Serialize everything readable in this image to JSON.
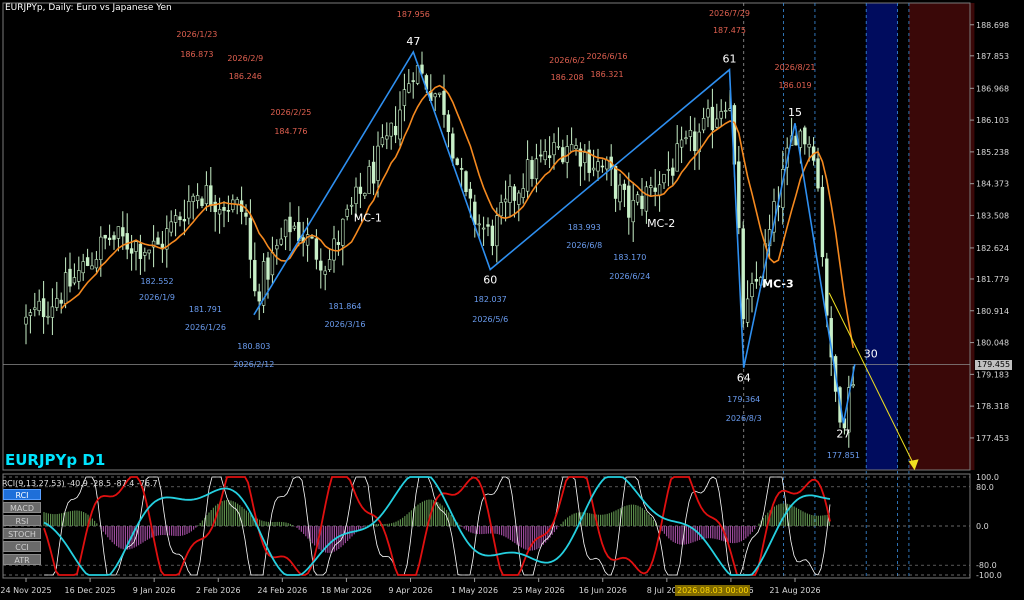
{
  "window": {
    "title": "EURJPYp, Daily:  Euro vs Japanese Yen",
    "symbol_label": "EURJPYp D1"
  },
  "indicator": {
    "caption": "RCI(9,13,27,53) -40.9 -28.5 -87.4 -76.7",
    "buttons": [
      {
        "label": "RCI",
        "active": true
      },
      {
        "label": "MACD",
        "active": false
      },
      {
        "label": "RSI",
        "active": false
      },
      {
        "label": "STOCH",
        "active": false
      },
      {
        "label": "CCI",
        "active": false
      },
      {
        "label": "ATR",
        "active": false
      }
    ],
    "levels": [
      "100.0",
      "80.0",
      "0.0",
      "-80.0",
      "-100.0"
    ]
  },
  "crosshair": {
    "date_label": "2026.08.03 00:00",
    "price_label": "179.455"
  },
  "colors": {
    "background": "#000000",
    "candle": "#c8f0c8",
    "ma": "#f5891f",
    "zigzag": "#2e8ff0",
    "forecast_arrow": "#f0e020",
    "label_high": "#e06050",
    "label_low": "#6a9cf0",
    "rci_fast": "#ffffff",
    "rci_mid": "#e01010",
    "rci_slow": "#25d0e0",
    "zone_blue": "#000c5e",
    "zone_red": "#3a0808"
  },
  "chart_data": {
    "type": "candlestick",
    "title": "EURJPYp, Daily:  Euro vs Japanese Yen",
    "x_ticks": [
      "24 Nov 2025",
      "16 Dec 2025",
      "9 Jan 2026",
      "2 Feb 2026",
      "24 Feb 2026",
      "18 Mar 2026",
      "9 Apr 2026",
      "1 May 2026",
      "25 May 2026",
      "16 Jun 2026",
      "8 Jul 2026",
      "30 Jul 2026",
      "21 Aug 2026"
    ],
    "y_ticks": [
      188.698,
      187.853,
      186.968,
      186.103,
      185.238,
      184.373,
      183.508,
      182.624,
      181.779,
      180.914,
      180.048,
      179.183,
      178.318,
      177.453
    ],
    "ylim": [
      176.58,
      189.29
    ],
    "current_price": 179.455,
    "anchors": [
      {
        "date": "2025-11-24",
        "price": 180.6
      },
      {
        "date": "2025-12-09",
        "price": 181.6
      },
      {
        "date": "2025-12-23",
        "price": 182.9
      },
      {
        "date": "2026-01-09",
        "price": 182.6
      },
      {
        "date": "2026-01-23",
        "price": 184.2
      },
      {
        "date": "2026-02-09",
        "price": 183.6
      },
      {
        "date": "2026-02-12",
        "price": 181.3
      },
      {
        "date": "2026-02-25",
        "price": 183.3
      },
      {
        "date": "2026-03-10",
        "price": 182.2
      },
      {
        "date": "2026-03-16",
        "price": 183.3
      },
      {
        "date": "2026-04-01",
        "price": 185.6
      },
      {
        "date": "2026-04-09",
        "price": 187.6
      },
      {
        "date": "2026-04-20",
        "price": 186.5
      },
      {
        "date": "2026-04-28",
        "price": 183.7
      },
      {
        "date": "2026-05-06",
        "price": 182.9
      },
      {
        "date": "2026-05-18",
        "price": 184.6
      },
      {
        "date": "2026-06-02",
        "price": 185.5
      },
      {
        "date": "2026-06-16",
        "price": 184.7
      },
      {
        "date": "2026-06-24",
        "price": 183.6
      },
      {
        "date": "2026-07-08",
        "price": 184.8
      },
      {
        "date": "2026-07-20",
        "price": 185.8
      },
      {
        "date": "2026-07-29",
        "price": 186.9
      },
      {
        "date": "2026-08-03",
        "price": 180.6
      },
      {
        "date": "2026-08-10",
        "price": 182.3
      },
      {
        "date": "2026-08-21",
        "price": 185.9
      },
      {
        "date": "2026-08-28",
        "price": 185.4
      },
      {
        "date": "2026-09-03",
        "price": 179.0
      },
      {
        "date": "2026-09-07",
        "price": 178.0
      },
      {
        "date": "2026-09-11",
        "price": 179.4
      }
    ],
    "zigzag": [
      {
        "date": "2026-02-12",
        "price": 180.803,
        "label": ""
      },
      {
        "date": "2026-04-09",
        "price": 187.956,
        "label": "47"
      },
      {
        "date": "2026-05-06",
        "price": 182.037,
        "label": "60"
      },
      {
        "date": "2026-07-29",
        "price": 187.475,
        "label": "61"
      },
      {
        "date": "2026-08-03",
        "price": 179.364,
        "label": "64"
      },
      {
        "date": "2026-08-21",
        "price": 186.019,
        "label": "15"
      },
      {
        "date": "2026-09-07",
        "price": 177.851,
        "label": "27"
      },
      {
        "date": "2026-09-11",
        "price": 179.455,
        "label": "30"
      }
    ],
    "wave_labels": [
      {
        "text": "MC-1",
        "date": "2026-03-24",
        "price": 183.35
      },
      {
        "text": "MC-2",
        "date": "2026-07-05",
        "price": 183.2
      },
      {
        "text": "MC-3",
        "date": "2026-08-15",
        "price": 181.55
      }
    ],
    "swing_annotations": [
      {
        "date_text": "2026/1/23",
        "price_text": "186.873",
        "date": "2026-01-23",
        "kind": "high"
      },
      {
        "date_text": "2026/2/9",
        "price_text": "186.246",
        "date": "2026-02-09",
        "kind": "high"
      },
      {
        "date_text": "2026/2/25",
        "price_text": "184.776",
        "date": "2026-02-25",
        "kind": "high"
      },
      {
        "date_text": "",
        "price_text": "187.956",
        "date": "2026-04-09",
        "kind": "high"
      },
      {
        "date_text": "2026/6/2",
        "price_text": "186.208",
        "date": "2026-06-02",
        "kind": "high"
      },
      {
        "date_text": "2026/6/16",
        "price_text": "186.321",
        "date": "2026-06-16",
        "kind": "high"
      },
      {
        "date_text": "2026/7/29",
        "price_text": "187.475",
        "date": "2026-07-29",
        "kind": "high"
      },
      {
        "date_text": "2026/8/21",
        "price_text": "186.019",
        "date": "2026-08-21",
        "kind": "high"
      },
      {
        "date_text": "2026/1/9",
        "price_text": "182.552",
        "date": "2026-01-09",
        "kind": "low"
      },
      {
        "date_text": "2026/1/26",
        "price_text": "181.791",
        "date": "2026-01-26",
        "kind": "low"
      },
      {
        "date_text": "2026/2/12",
        "price_text": "180.803",
        "date": "2026-02-12",
        "kind": "low"
      },
      {
        "date_text": "2026/3/16",
        "price_text": "181.864",
        "date": "2026-03-16",
        "kind": "low"
      },
      {
        "date_text": "2026/5/6",
        "price_text": "182.037",
        "date": "2026-05-06",
        "kind": "low"
      },
      {
        "date_text": "2026/6/8",
        "price_text": "183.993",
        "date": "2026-06-08",
        "kind": "low"
      },
      {
        "date_text": "2026/6/24",
        "price_text": "183.170",
        "date": "2026-06-24",
        "kind": "low"
      },
      {
        "date_text": "2026/8/3",
        "price_text": "179.364",
        "date": "2026-08-03",
        "kind": "low"
      },
      {
        "date_text": "",
        "price_text": "177.851",
        "date": "2026-09-07",
        "kind": "low"
      }
    ],
    "forecast_arrow": {
      "from": {
        "date": "2026-09-02",
        "price": 181.4
      },
      "to": {
        "date": "2026-10-02",
        "price": 176.6
      }
    },
    "time_zones": [
      {
        "from": "2026-09-15",
        "to": "2026-09-26",
        "color": "blue"
      },
      {
        "from": "2026-09-30",
        "to": "2026-10-23",
        "color": "red"
      }
    ],
    "vertical_markers": [
      "2026-08-03",
      "2026-08-17",
      "2026-08-28",
      "2026-09-15",
      "2026-09-26",
      "2026-09-30"
    ],
    "rci": {
      "ylim": [
        -100,
        100
      ],
      "levels": [
        100,
        80,
        0,
        -80,
        -100
      ],
      "last_values": [
        -40.9,
        -28.5,
        -87.4,
        -76.7
      ]
    }
  }
}
